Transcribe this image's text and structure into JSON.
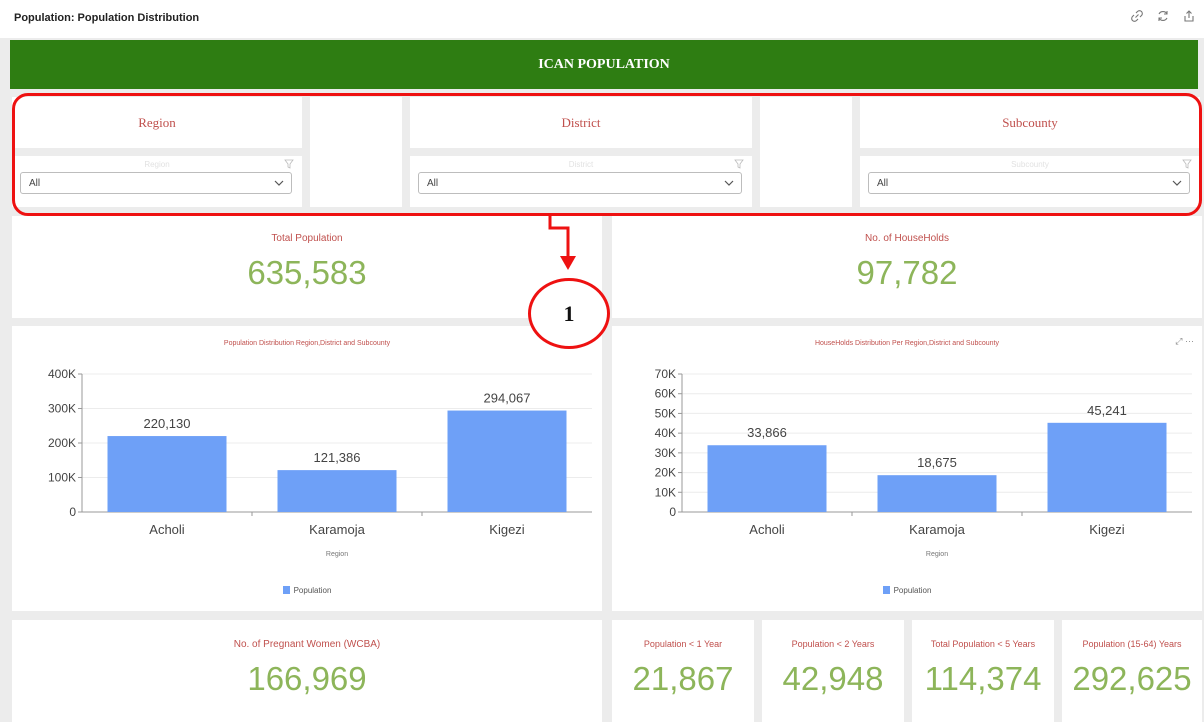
{
  "page": {
    "title": "Population: Population Distribution"
  },
  "toolbar": {
    "icons": [
      "link-icon",
      "refresh-icon",
      "share-icon"
    ]
  },
  "banner": {
    "title": "ICAN POPULATION"
  },
  "filters": [
    {
      "title": "Region",
      "label": "Region",
      "value": "All"
    },
    {
      "title": "District",
      "label": "District",
      "value": "All"
    },
    {
      "title": "Subcounty",
      "label": "Subcounty",
      "value": "All"
    }
  ],
  "annotation": {
    "number": "1",
    "color": "#ee1111"
  },
  "kpis": {
    "total_population": {
      "title": "Total Population",
      "value": "635,583"
    },
    "households": {
      "title": "No. of HouseHolds",
      "value": "97,782"
    },
    "pregnant": {
      "title": "No. of Pregnant Women (WCBA)",
      "value": "166,969"
    },
    "pop_1": {
      "title": "Population < 1 Year",
      "value": "21,867"
    },
    "pop_2": {
      "title": "Population < 2 Years",
      "value": "42,948"
    },
    "pop_5": {
      "title": "Total Population < 5 Years",
      "value": "114,374"
    },
    "pop_15_64": {
      "title": "Population (15-64) Years",
      "value": "292,625"
    }
  },
  "colors": {
    "banner": "#2e7d12",
    "accent": "#c0504d",
    "kpi_value": "#8db55a",
    "bar": "#6ea0f7"
  },
  "chart_data": [
    {
      "type": "bar",
      "title": "Population Distribution Region,District and Subcounty",
      "categories": [
        "Acholi",
        "Karamoja",
        "Kigezi"
      ],
      "series": [
        {
          "name": "Population",
          "values": [
            220130,
            121386,
            294067
          ]
        }
      ],
      "value_labels": [
        "220,130",
        "121,386",
        "294,067"
      ],
      "yticks": [
        0,
        100000,
        200000,
        300000,
        400000
      ],
      "ytick_labels": [
        "0",
        "100K",
        "200K",
        "300K",
        "400K"
      ],
      "ylim": [
        0,
        400000
      ],
      "xlabel": "Region",
      "ylabel": "",
      "legend": "bottom",
      "grid": true
    },
    {
      "type": "bar",
      "title": "HouseHolds Distribution Per Region,District and Subcounty",
      "categories": [
        "Acholi",
        "Karamoja",
        "Kigezi"
      ],
      "series": [
        {
          "name": "Population",
          "values": [
            33866,
            18675,
            45241
          ]
        }
      ],
      "value_labels": [
        "33,866",
        "18,675",
        "45,241"
      ],
      "yticks": [
        0,
        10000,
        20000,
        30000,
        40000,
        50000,
        60000,
        70000
      ],
      "ytick_labels": [
        "0",
        "10K",
        "20K",
        "30K",
        "40K",
        "50K",
        "60K",
        "70K"
      ],
      "ylim": [
        0,
        70000
      ],
      "xlabel": "Region",
      "ylabel": "",
      "legend": "bottom",
      "grid": true
    }
  ]
}
